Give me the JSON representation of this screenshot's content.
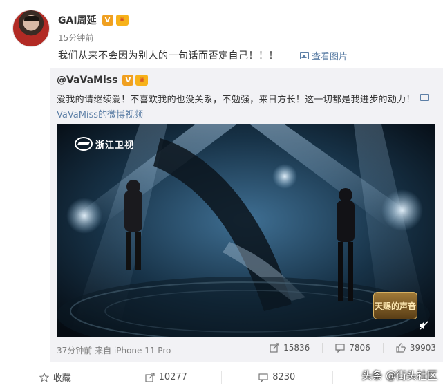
{
  "post": {
    "author": "GAI周延",
    "verified_badge": "V",
    "crown_badge": "♛",
    "time": "15分钟前",
    "text": "我们从来不会因为别人的一句话而否定自己！！！",
    "view_pictures": "查看图片"
  },
  "repost": {
    "author": "@VaVaMiss",
    "verified_badge": "V",
    "crown_badge": "♛",
    "text": "爱我的请继续爱！不喜欢我的也没关系，不勉强，来日方长！这一切都是我进步的动力！",
    "video_link": "VaVaMiss的微博视频",
    "video": {
      "channel": "浙江卫视",
      "show_logo": "天赐的声音"
    },
    "time_source": "37分钟前 来自 iPhone 11 Pro",
    "reposts": "15836",
    "comments": "7806",
    "likes": "39903"
  },
  "footer": {
    "favorite": "收藏",
    "reposts": "10277",
    "comments": "8230"
  },
  "watermark": "头条 @街头社区",
  "colors": {
    "link": "#5d7fa6",
    "badge_orange": "#f0a020",
    "repost_bg": "#f2f2f5"
  }
}
